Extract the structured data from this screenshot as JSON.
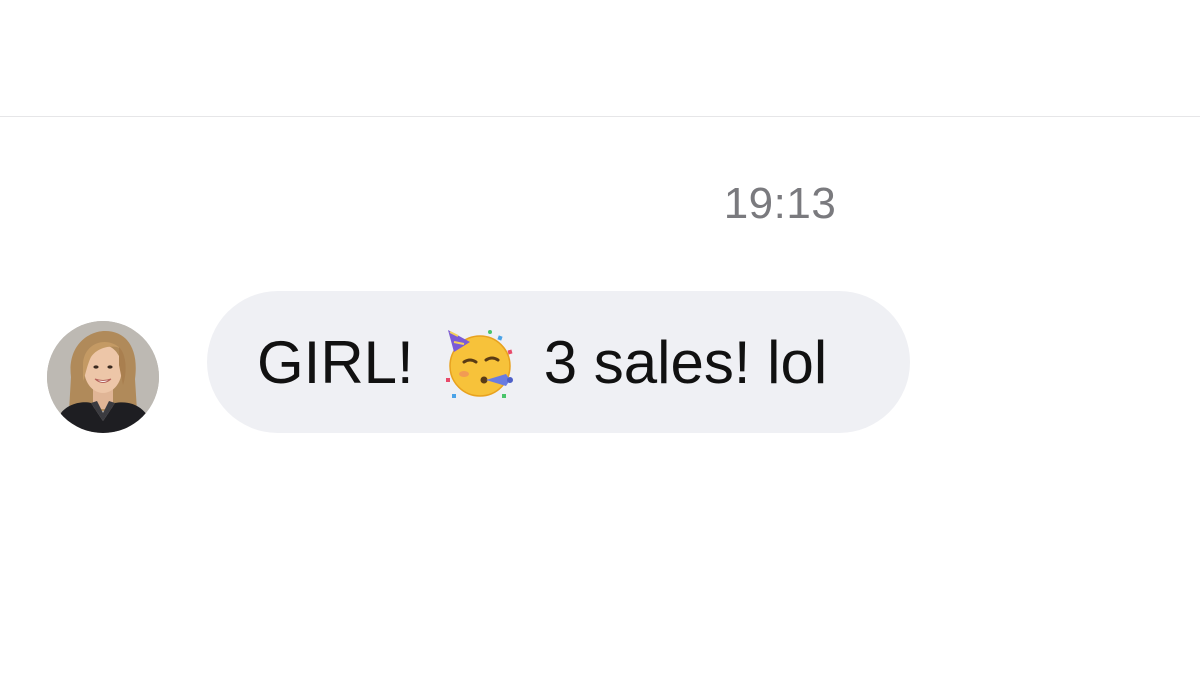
{
  "conversation": {
    "timestamp": "19:13",
    "message": {
      "text_before_emoji": "GIRL!",
      "emoji": "partying-face-icon",
      "text_after_emoji": "3 sales! lol",
      "bubble_color": "#eff0f4",
      "text_color": "#111111"
    },
    "sender": {
      "avatar": "profile-photo"
    }
  },
  "colors": {
    "background": "#ffffff",
    "divider": "#e6e6e8",
    "timestamp": "#7a7a7e"
  }
}
